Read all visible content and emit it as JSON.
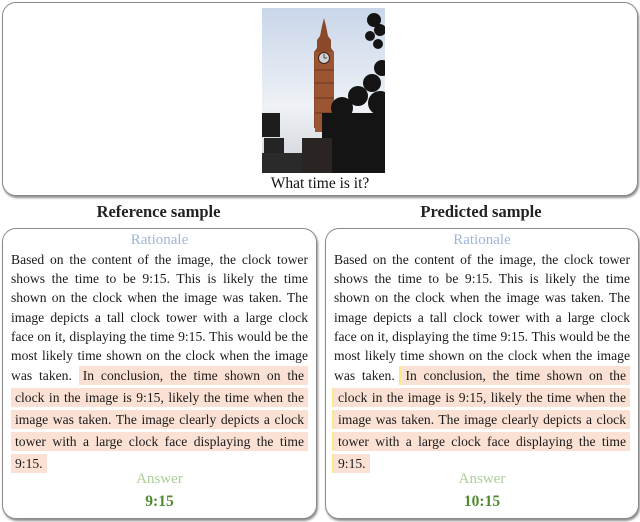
{
  "question": {
    "image_alt": "Photo of a tall clock tower (Big Ben) with trees and street signs",
    "text": "What time is it?"
  },
  "reference": {
    "title": "Reference sample",
    "rationale_label": "Rationale",
    "rationale_plain": "Based on the content of the image, the clock tower shows the time to be 9:15. This is likely the time shown on the clock when the image was taken. The image depicts a tall clock tower with a large clock face on it, displaying the time 9:15. This would be the most likely time shown on the clock when the image was taken.",
    "rationale_highlight": "In conclusion, the time shown on the clock in the image is 9:15, likely the time when the image was taken. The image clearly depicts a clock tower with a large clock face displaying the time 9:15.",
    "answer_label": "Answer",
    "answer_value": "9:15"
  },
  "predicted": {
    "title": "Predicted sample",
    "rationale_label": "Rationale",
    "rationale_plain": "Based on the content of the image, the clock tower shows the time to be 9:15. This is likely the time shown on the clock when the image was taken. The image depicts a tall clock tower with a large clock face on it, displaying the time 9:15. This would be the most likely time shown on the clock when the image was taken.",
    "rationale_highlight": "In conclusion, the time shown on the clock in the image is 9:15, likely the time when the image was taken. The image clearly depicts a clock tower with a large clock face displaying the time 9:15.",
    "answer_label": "Answer",
    "answer_value": "10:15"
  },
  "colors": {
    "rationale_label": "#9fb6d9",
    "answer_label": "#a9cf97",
    "answer_value": "#4f8a2f",
    "highlight": "#fbe1d4"
  }
}
